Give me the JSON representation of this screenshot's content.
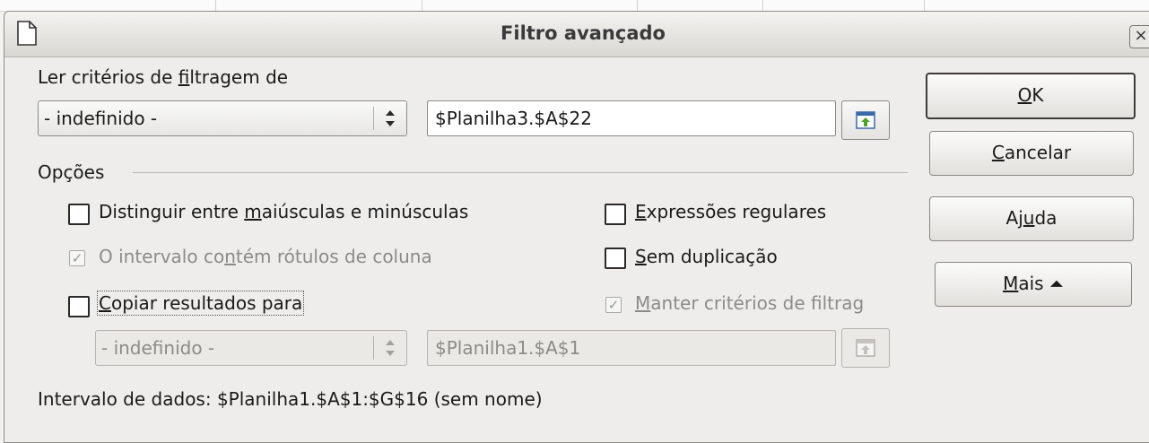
{
  "dialog": {
    "title": "Filtro avançado",
    "close_label": "×"
  },
  "criteria": {
    "heading_pre": "Ler critérios de ",
    "heading_mn": "f",
    "heading_post": "iltragem de",
    "combo_value": "- indefinido -",
    "range_value": "$Planilha3.$A$22"
  },
  "options": {
    "heading": "Opções",
    "case_sensitive": {
      "pre": "Distinguir entre ",
      "mn": "m",
      "post": "aiúsculas e minúsculas",
      "checked": false
    },
    "column_labels": {
      "pre": "O intervalo co",
      "mn": "n",
      "post": "tém rótulos de coluna",
      "checked": true,
      "enabled": false
    },
    "copy_results": {
      "pre": "",
      "mn": "C",
      "post": "opiar resultados para",
      "checked": false
    },
    "regex": {
      "pre": "",
      "mn": "E",
      "post": "xpressões regulares",
      "checked": false
    },
    "no_duplicates": {
      "pre": "",
      "mn": "S",
      "post": "em duplicação",
      "checked": false
    },
    "keep_criteria": {
      "pre": "",
      "mn": "M",
      "post": "anter critérios de filtrag",
      "checked": true,
      "enabled": false
    },
    "copy_combo_value": "- indefinido -",
    "copy_range_value": "$Planilha1.$A$1"
  },
  "status": {
    "data_range": "Intervalo de dados: $Planilha1.$A$1:$G$16 (sem nome)"
  },
  "buttons": {
    "ok": {
      "mn": "O",
      "post": "K"
    },
    "cancel": {
      "mn": "C",
      "post": "ancelar"
    },
    "help": {
      "pre": "Aj",
      "mn": "u",
      "post": "da"
    },
    "more": {
      "mn": "M",
      "post": "ais",
      "arrow": "⏶"
    }
  }
}
